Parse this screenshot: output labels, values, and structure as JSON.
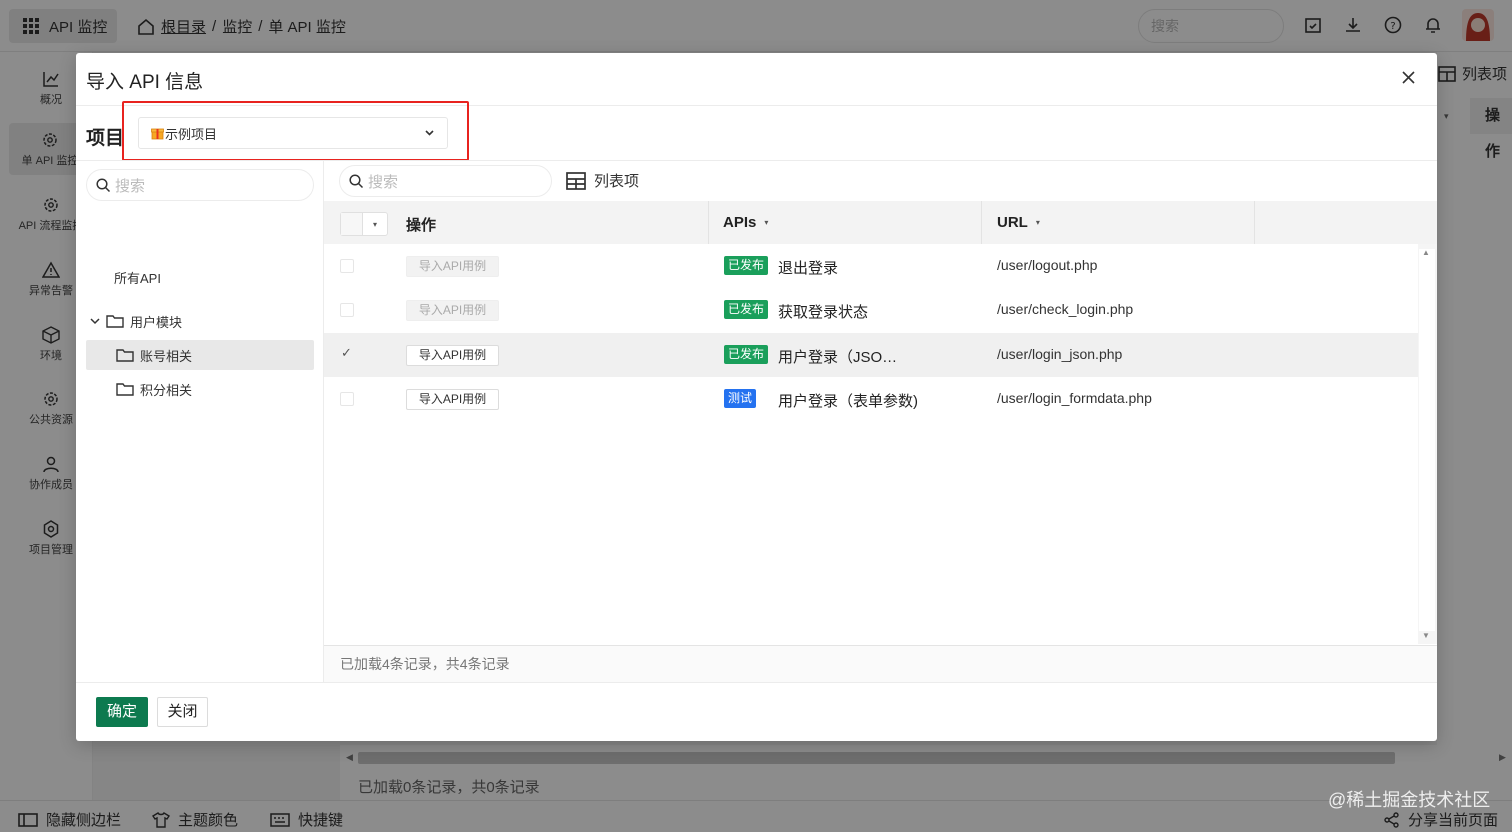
{
  "colors": {
    "accent": "#0d7a4f",
    "published_tag": "#1a9f5b",
    "test_tag": "#2472f0",
    "highlight": "#e8231f"
  },
  "topbar": {
    "app_name": "API 监控",
    "breadcrumb": {
      "root": "根目录",
      "sep1": "/",
      "item1": "监控",
      "sep2": "/",
      "item2": "单 API 监控"
    },
    "search_placeholder": "搜索",
    "icons": [
      "calendar-check-icon",
      "download-icon",
      "help-icon",
      "bell-icon"
    ]
  },
  "sidenav": {
    "items": [
      {
        "label": "概况",
        "icon": "chart-icon"
      },
      {
        "label": "单 API 监控",
        "icon": "gear-icon"
      },
      {
        "label": "API 流程监控",
        "icon": "gear-icon"
      },
      {
        "label": "异常告警",
        "icon": "warning-icon"
      },
      {
        "label": "环境",
        "icon": "cube-icon"
      },
      {
        "label": "公共资源",
        "icon": "gear-icon"
      },
      {
        "label": "协作成员",
        "icon": "user-icon"
      },
      {
        "label": "项目管理",
        "icon": "settings-icon"
      }
    ]
  },
  "background": {
    "list_columns_label": "列表项",
    "op_header": "操作",
    "records": "已加载0条记录，共0条记录"
  },
  "statusbar": {
    "hide_sidebar": "隐藏侧边栏",
    "theme_color": "主题颜色",
    "shortcuts": "快捷键",
    "share": "分享当前页面",
    "watermark": "@稀土掘金技术社区"
  },
  "modal": {
    "title": "导入 API 信息",
    "project_label": "项目",
    "project_value": "示例项目",
    "tree": {
      "search_placeholder": "搜索",
      "all_api": "所有API",
      "module": "用户模块",
      "children": [
        "账号相关",
        "积分相关"
      ]
    },
    "grid": {
      "search_placeholder": "搜索",
      "list_columns_label": "列表项",
      "columns": {
        "op": "操作",
        "apis": "APIs",
        "url": "URL"
      },
      "rows": [
        {
          "action": "导入API用例",
          "action_disabled": true,
          "checked": false,
          "status": "已发布",
          "status_kind": "published",
          "name": "退出登录",
          "url": "/user/logout.php"
        },
        {
          "action": "导入API用例",
          "action_disabled": true,
          "checked": false,
          "status": "已发布",
          "status_kind": "published",
          "name": "获取登录状态",
          "url": "/user/check_login.php"
        },
        {
          "action": "导入API用例",
          "action_disabled": false,
          "checked": true,
          "status": "已发布",
          "status_kind": "published",
          "name": "用户登录（JSO…",
          "url": "/user/login_json.php"
        },
        {
          "action": "导入API用例",
          "action_disabled": false,
          "checked": false,
          "status": "测试",
          "status_kind": "test",
          "name": "用户登录（表单参数)",
          "url": "/user/login_formdata.php"
        }
      ],
      "footer": "已加载4条记录，共4条记录"
    },
    "confirm": "确定",
    "close": "关闭"
  }
}
